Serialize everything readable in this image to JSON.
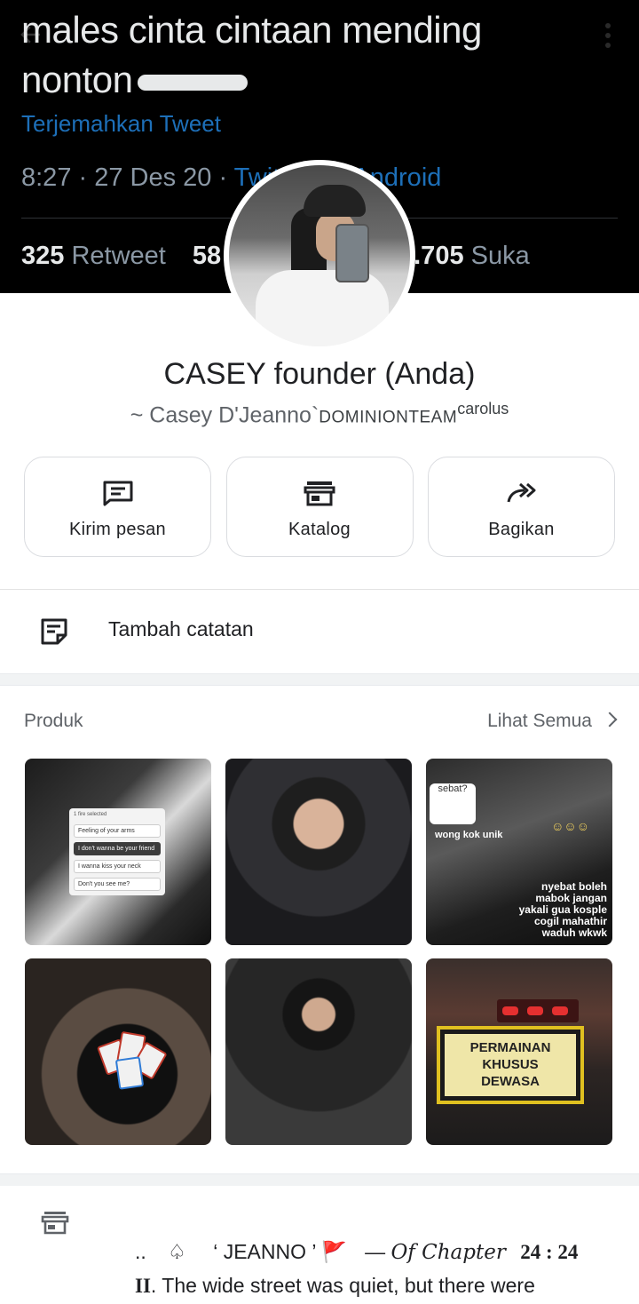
{
  "cover": {
    "tweet_line1": "males cinta cintaan mending",
    "tweet_line2": "nonton",
    "translate": "Terjemahkan Tweet",
    "meta": "8:27 · 27 Des 20 · ",
    "source": "Twitter for Android",
    "retweets_count": "325",
    "retweets_label": " Retweet",
    "quotes_count": "58",
    "likes_count": "2.705",
    "likes_label": " Suka"
  },
  "profile": {
    "name": "CASEY founder (Anda)",
    "about_prefix": "~ Casey D'Jeanno`",
    "about_team": "DOMINIONTEAM",
    "about_sup": "carolus"
  },
  "actions": [
    {
      "label": "Kirim pesan",
      "icon": "message-icon"
    },
    {
      "label": "Katalog",
      "icon": "storefront-icon"
    },
    {
      "label": "Bagikan",
      "icon": "share-icon"
    }
  ],
  "note": {
    "label": "Tambah catatan",
    "icon": "note-icon"
  },
  "products": {
    "title": "Produk",
    "see_all": "Lihat Semua",
    "poll_header": "1 fire selected",
    "poll_options": [
      "Feeling of your arms",
      "I don't wanna be your friend",
      "I wanna kiss your neck",
      "Don't you see me?"
    ],
    "t3_sticker": "sebat?",
    "t3_caption_top": "wong kok unik",
    "t3_caption_bottom": "nyebat boleh\nmabok jangan\nyakali gua kosple\ncogil mahathir\nwaduh wkwk",
    "t6_sign": "PERMAINAN\nKHUSUS\nDEWASA"
  },
  "description": {
    "dots": "..",
    "spade": "♤",
    "name": "‘ JEANNO ’",
    "flag": "🚩",
    "dash": "—",
    "chapter": "Of Chapter",
    "time": "24 : 24",
    "line2_num": "II",
    "line2_text": ". The wide street was quiet, but there  were"
  },
  "colors": {
    "link": "#1d6fb8",
    "divider": "#dadce0",
    "muted": "#5f6368"
  }
}
